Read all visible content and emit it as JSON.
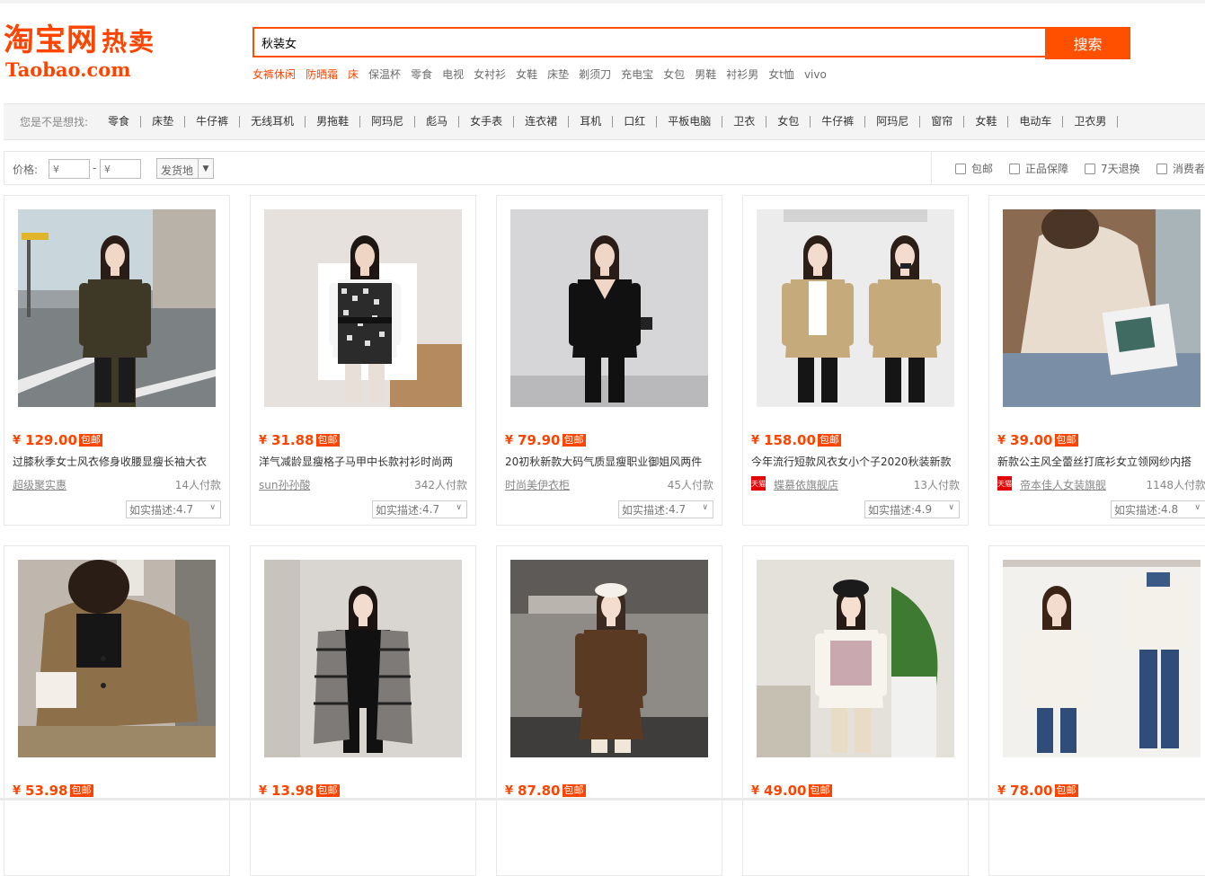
{
  "logo": {
    "cn": "淘宝网",
    "hot": "热卖",
    "en": "Taobao.com"
  },
  "search": {
    "query": "秋装女",
    "button": "搜索"
  },
  "hot_words": [
    {
      "text": "女裤休闲",
      "red": true
    },
    {
      "text": "防晒霜",
      "red": true
    },
    {
      "text": "床",
      "red": true
    },
    {
      "text": "保温杯",
      "red": false
    },
    {
      "text": "零食",
      "red": false
    },
    {
      "text": "电视",
      "red": false
    },
    {
      "text": "女衬衫",
      "red": false
    },
    {
      "text": "女鞋",
      "red": false
    },
    {
      "text": "床垫",
      "red": false
    },
    {
      "text": "剃须刀",
      "red": false
    },
    {
      "text": "充电宝",
      "red": false
    },
    {
      "text": "女包",
      "red": false
    },
    {
      "text": "男鞋",
      "red": false
    },
    {
      "text": "衬衫男",
      "red": false
    },
    {
      "text": "女t恤",
      "red": false
    },
    {
      "text": "vivo",
      "red": false
    }
  ],
  "suggest": {
    "label": "您是不是想找:",
    "items": [
      "零食",
      "床垫",
      "牛仔裤",
      "无线耳机",
      "男拖鞋",
      "阿玛尼",
      "彪马",
      "女手表",
      "连衣裙",
      "耳机",
      "口红",
      "平板电脑",
      "卫衣",
      "女包",
      "牛仔裤",
      "阿玛尼",
      "窗帘",
      "女鞋",
      "电动车",
      "卫衣男"
    ]
  },
  "filter": {
    "price_label": "价格:",
    "price_placeholder": "¥",
    "dash": "-",
    "ship_from": "发货地",
    "ship_arrow": "▼",
    "options": [
      "包邮",
      "正品保障",
      "7天退换",
      "消费者保障"
    ]
  },
  "currency": "¥",
  "free_ship": "包邮",
  "desc_label": "如实描述:",
  "tmall_text": "天猫",
  "products": [
    {
      "price": "129.00",
      "title": "过膝秋季女士风衣修身收腰显瘦长袖大衣",
      "shop": "超级聚实惠",
      "sold": "14人付款",
      "rating": "4.7",
      "tmall": false
    },
    {
      "price": "31.88",
      "title": "洋气减龄显瘦格子马甲中长款衬衫时尚两",
      "shop": "sun孙孙酸",
      "sold": "342人付款",
      "rating": "4.7",
      "tmall": false
    },
    {
      "price": "79.90",
      "title": "20初秋新款大码气质显瘦职业御姐风两件",
      "shop": "时尚美伊衣柜",
      "sold": "45人付款",
      "rating": "4.7",
      "tmall": false
    },
    {
      "price": "158.00",
      "title": "今年流行短款风衣女小个子2020秋装新款",
      "shop": "蝶慕依旗舰店",
      "sold": "13人付款",
      "rating": "4.9",
      "tmall": true
    },
    {
      "price": "39.00",
      "title": "新款公主风全蕾丝打底衫女立领网纱内搭",
      "shop": "帝本佳人女装旗舰",
      "sold": "1148人付款",
      "rating": "4.8",
      "tmall": true
    },
    {
      "price": "53.98"
    },
    {
      "price": "13.98"
    },
    {
      "price": "87.80"
    },
    {
      "price": "49.00"
    },
    {
      "price": "78.00"
    }
  ]
}
